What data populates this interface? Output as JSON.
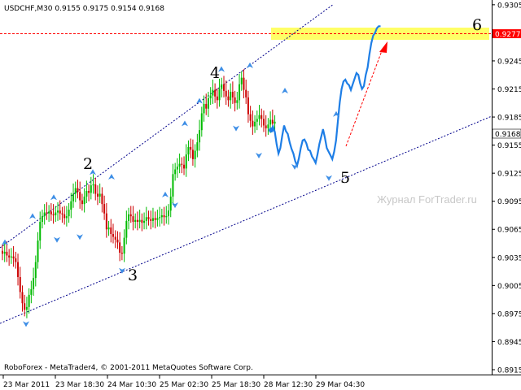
{
  "chart_data": {
    "type": "candlestick",
    "symbol": "USDCHF",
    "timeframe": "M30",
    "header_text": "USDCHF,M30  0.9155 0.9175 0.9154 0.9168",
    "ohlc": {
      "open": 0.9155,
      "high": 0.9175,
      "low": 0.9154,
      "close": 0.9168
    },
    "ylim": [
      0.8915,
      0.9304
    ],
    "y_ticks": [
      "0.9305",
      "0.9275",
      "0.9245",
      "0.9215",
      "0.9185",
      "0.9155",
      "0.9125",
      "0.9095",
      "0.9065",
      "0.9035",
      "0.9005",
      "0.8975",
      "0.8945",
      "0.8915"
    ],
    "x_ticks": [
      "23 Mar 2011",
      "23 Mar 18:30",
      "24 Mar 10:30",
      "25 Mar 02:30",
      "25 Mar 18:30",
      "28 Mar 12:30",
      "29 Mar 04:30"
    ],
    "current_price": "0.9168",
    "target_price": "0.9277",
    "wave_labels": [
      "2",
      "3",
      "4",
      "5",
      "6"
    ],
    "footer": "RoboForex - MetaTrader4, © 2001-2011 MetaQuotes Software Corp.",
    "watermark": "Журнал ForTrader.ru",
    "colors": {
      "bull_candle": "#00bb00",
      "bear_candle": "#cc0000",
      "forecast_line": "#1e7ee6",
      "fractal_arrows": "#3d8ee6",
      "channel_lines": "#00008b",
      "target_zone": "#ffff66",
      "target_line": "#ff0000",
      "arrow": "#ff0000"
    },
    "series": [
      {
        "values": [
          0.9039,
          0.9041,
          0.9037,
          0.9035,
          0.9036,
          0.9034,
          0.903,
          0.9014,
          0.8998,
          0.8986,
          0.8979,
          0.8982,
          0.8995,
          0.9001,
          0.9013,
          0.903,
          0.9053,
          0.9073,
          0.9079,
          0.9083,
          0.9082,
          0.9084,
          0.9081,
          0.908,
          0.9083,
          0.9085,
          0.9082,
          0.9081,
          0.9077,
          0.9079,
          0.9086,
          0.9095,
          0.9103,
          0.9109,
          0.9105,
          0.9096,
          0.9092,
          0.91,
          0.9106,
          0.9104,
          0.9112,
          0.9113,
          0.9103,
          0.91,
          0.9103,
          0.9092,
          0.9082,
          0.9065,
          0.9067,
          0.906,
          0.9057,
          0.9054,
          0.9051,
          0.904,
          0.9039,
          0.9056,
          0.9074,
          0.9081,
          0.9079,
          0.9073,
          0.9075,
          0.9073,
          0.9075,
          0.9072,
          0.9074,
          0.9078,
          0.9076,
          0.9074,
          0.9077,
          0.9075,
          0.9077,
          0.9078,
          0.908,
          0.9078,
          0.9079,
          0.9085,
          0.91,
          0.9124,
          0.9129,
          0.9132,
          0.9135,
          0.9134,
          0.913,
          0.9145,
          0.9153,
          0.915,
          0.914,
          0.9149,
          0.9158,
          0.9171,
          0.9189,
          0.9199,
          0.9194,
          0.9205,
          0.9208,
          0.9214,
          0.9207,
          0.9203,
          0.9215,
          0.922,
          0.9213,
          0.9207,
          0.9203,
          0.9212,
          0.9206,
          0.92,
          0.9203,
          0.922,
          0.9227,
          0.9214,
          0.9206,
          0.9188,
          0.9181,
          0.9175,
          0.918,
          0.9183,
          0.9187,
          0.9183,
          0.9176,
          0.9173,
          0.9177,
          0.9182,
          0.9178,
          0.918
        ]
      },
      {
        "name": "",
        "values": [
          0.9171,
          0.9175,
          0.9169,
          0.9156,
          0.9146,
          0.9152,
          0.9165,
          0.9176,
          0.917,
          0.9167,
          0.9158,
          0.9151,
          0.9146,
          0.9138,
          0.9133,
          0.9141,
          0.9152,
          0.916,
          0.9161,
          0.9157,
          0.915,
          0.9149,
          0.9143,
          0.914,
          0.9136,
          0.9145,
          0.9156,
          0.9164,
          0.9172,
          0.9163,
          0.9152,
          0.9148,
          0.9144,
          0.914,
          0.9148,
          0.916,
          0.9181,
          0.9201,
          0.9215,
          0.9223,
          0.9225,
          0.9221,
          0.9219,
          0.9214,
          0.922,
          0.9226,
          0.9232,
          0.923,
          0.9221,
          0.9215,
          0.9218,
          0.923,
          0.9238,
          0.9252,
          0.9264,
          0.9272,
          0.9275,
          0.928,
          0.9282,
          0.9282
        ]
      }
    ]
  }
}
